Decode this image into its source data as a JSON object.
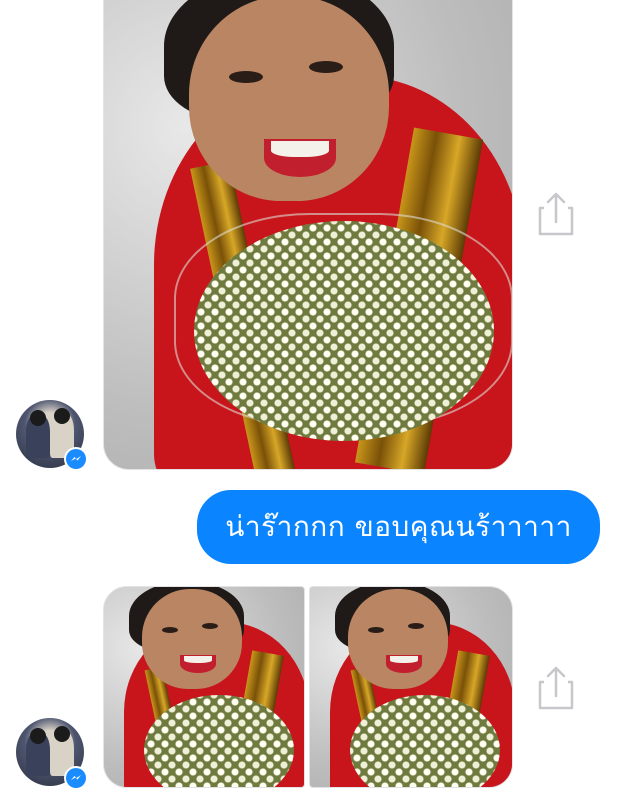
{
  "conversation": {
    "outgoing_message": "น่าร๊ากกก ขอบคุณนร้าาาาา"
  },
  "colors": {
    "bubble_blue": "#0a84ff",
    "messenger_blue": "#1a8cff",
    "share_icon_gray": "#c7c7cc"
  },
  "icons": {
    "share": "share-icon",
    "messenger": "messenger-badge-icon"
  }
}
